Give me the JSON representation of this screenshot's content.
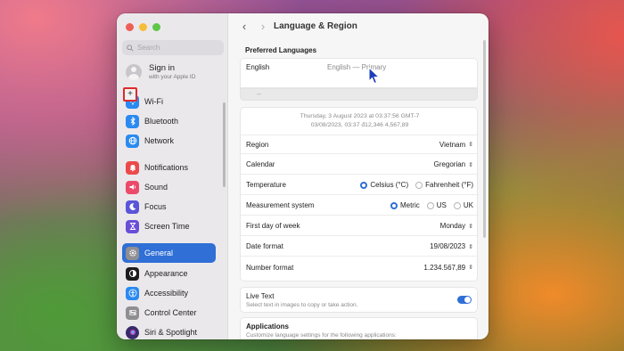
{
  "window": {
    "title": "Language & Region"
  },
  "sidebar": {
    "search_placeholder": "Search",
    "signin": {
      "title": "Sign in",
      "subtitle": "with your Apple ID"
    },
    "items": [
      {
        "label": "Wi-Fi",
        "icon": "wifi-icon",
        "color": "#2a8af0"
      },
      {
        "label": "Bluetooth",
        "icon": "bluetooth-icon",
        "color": "#2a8af0"
      },
      {
        "label": "Network",
        "icon": "globe-icon",
        "color": "#2a8af0"
      },
      {
        "label": "Notifications",
        "icon": "bell-icon",
        "color": "#ec4a4a"
      },
      {
        "label": "Sound",
        "icon": "speaker-icon",
        "color": "#ec4a6a"
      },
      {
        "label": "Focus",
        "icon": "moon-icon",
        "color": "#5a55d8"
      },
      {
        "label": "Screen Time",
        "icon": "hourglass-icon",
        "color": "#6a4ed8"
      },
      {
        "label": "General",
        "icon": "gear-icon",
        "color": "#8e8e93",
        "active": true
      },
      {
        "label": "Appearance",
        "icon": "appearance-icon",
        "color": "#1c1c1e"
      },
      {
        "label": "Accessibility",
        "icon": "accessibility-icon",
        "color": "#2a8af0"
      },
      {
        "label": "Control Center",
        "icon": "control-center-icon",
        "color": "#8e8e93"
      },
      {
        "label": "Siri & Spotlight",
        "icon": "siri-icon",
        "color": "#3a2a6a"
      }
    ]
  },
  "preferred_languages": {
    "title": "Preferred Languages",
    "items": [
      {
        "name": "English",
        "detail": "English — Primary"
      }
    ],
    "add_label": "+",
    "remove_label": "–"
  },
  "format_preview": {
    "line1": "Thursday, 3 August 2023 at 03:37:56 GMT-7",
    "line2": "03/08/2023, 03:37     đ12,346     4,567,89"
  },
  "settings": {
    "region": {
      "label": "Region",
      "value": "Vietnam"
    },
    "calendar": {
      "label": "Calendar",
      "value": "Gregorian"
    },
    "temperature": {
      "label": "Temperature",
      "options": [
        "Celsius (°C)",
        "Fahrenheit (°F)"
      ],
      "selected": "Celsius (°C)"
    },
    "measurement": {
      "label": "Measurement system",
      "options": [
        "Metric",
        "US",
        "UK"
      ],
      "selected": "Metric"
    },
    "first_day": {
      "label": "First day of week",
      "value": "Monday"
    },
    "date_format": {
      "label": "Date format",
      "value": "19/08/2023"
    },
    "number_format": {
      "label": "Number format",
      "value": "1.234.567,89"
    }
  },
  "live_text": {
    "title": "Live Text",
    "subtitle": "Select text in images to copy or take action.",
    "enabled": true
  },
  "applications": {
    "title": "Applications",
    "subtitle": "Customize language settings for the following applications:",
    "add_label": "+",
    "remove_label": "–"
  },
  "colors": {
    "accent": "#2f6fd6",
    "highlight": "#e02a2a"
  }
}
